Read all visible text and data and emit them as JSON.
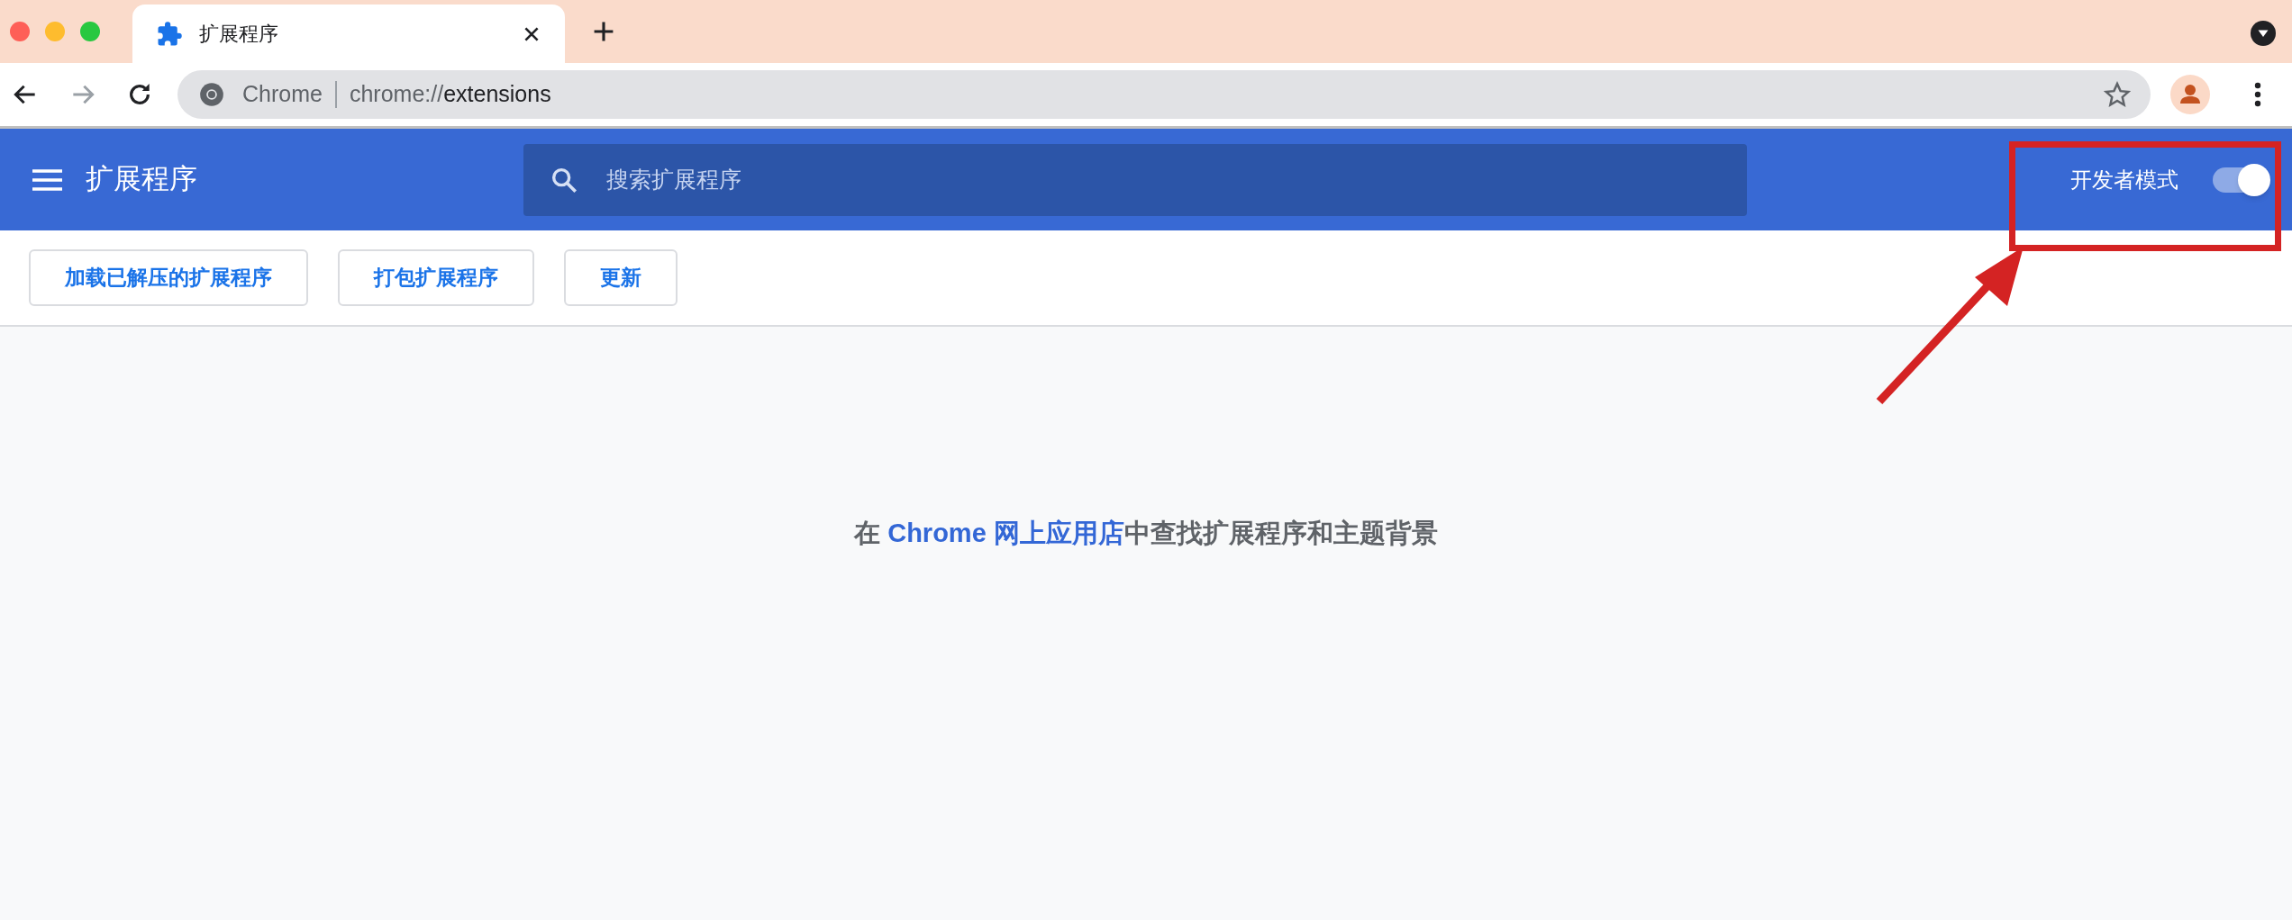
{
  "tab": {
    "title": "扩展程序",
    "selected": true
  },
  "toolbar": {
    "forward_disabled": true,
    "site_label": "Chrome",
    "url_prefix": "chrome://",
    "url_path": "extensions"
  },
  "header": {
    "title": "扩展程序",
    "search": {
      "placeholder": "搜索扩展程序"
    },
    "developer_mode": {
      "label": "开发者模式",
      "on": true
    }
  },
  "actions": [
    "加载已解压的扩展程序",
    "打包扩展程序",
    "更新"
  ],
  "empty_message": {
    "before": "在 ",
    "link": "Chrome 网上应用店",
    "after": "中查找扩展程序和主题背景"
  }
}
